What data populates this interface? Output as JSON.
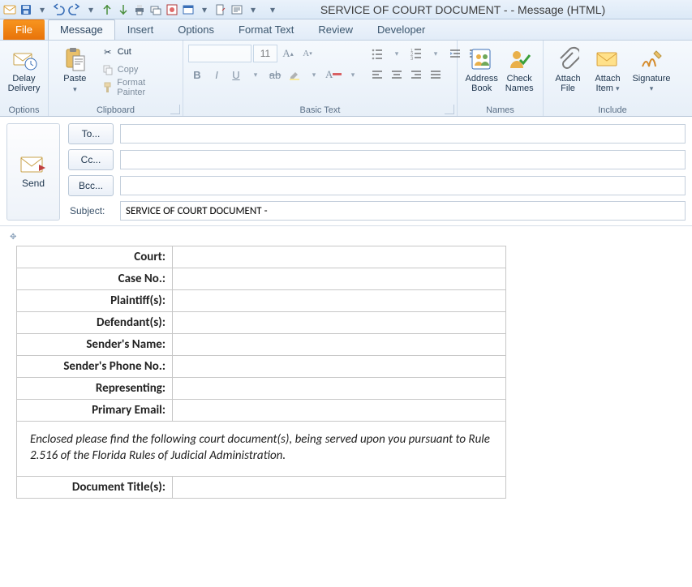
{
  "window": {
    "title": "SERVICE OF COURT DOCUMENT -  - Message (HTML)"
  },
  "tabs": {
    "file": "File",
    "message": "Message",
    "insert": "Insert",
    "options": "Options",
    "format_text": "Format Text",
    "review": "Review",
    "developer": "Developer"
  },
  "ribbon": {
    "options_group": "Options",
    "delay_delivery": "Delay\nDelivery",
    "clipboard_group": "Clipboard",
    "paste": "Paste",
    "cut": "Cut",
    "copy": "Copy",
    "format_painter": "Format Painter",
    "basic_text_group": "Basic Text",
    "font_size": "11",
    "names_group": "Names",
    "address_book": "Address\nBook",
    "check_names": "Check\nNames",
    "include_group": "Include",
    "attach_file": "Attach\nFile",
    "attach_item": "Attach\nItem",
    "signature": "Signature"
  },
  "compose": {
    "send": "Send",
    "to": "To...",
    "cc": "Cc...",
    "bcc": "Bcc...",
    "subject_label": "Subject:",
    "subject_value": "SERVICE OF COURT DOCUMENT - "
  },
  "body": {
    "rows": {
      "court": "Court:",
      "case_no": "Case No.:",
      "plaintiffs": "Plaintiff(s):",
      "defendants": "Defendant(s):",
      "sender_name": "Sender's Name:",
      "sender_phone": "Sender's Phone No.:",
      "representing": "Representing:",
      "primary_email": "Primary Email:",
      "document_titles": "Document Title(s):"
    },
    "message": "Enclosed please find  the following court document(s), being served upon you pursuant to Rule 2.516 of the Florida Rules of Judicial Administration."
  }
}
